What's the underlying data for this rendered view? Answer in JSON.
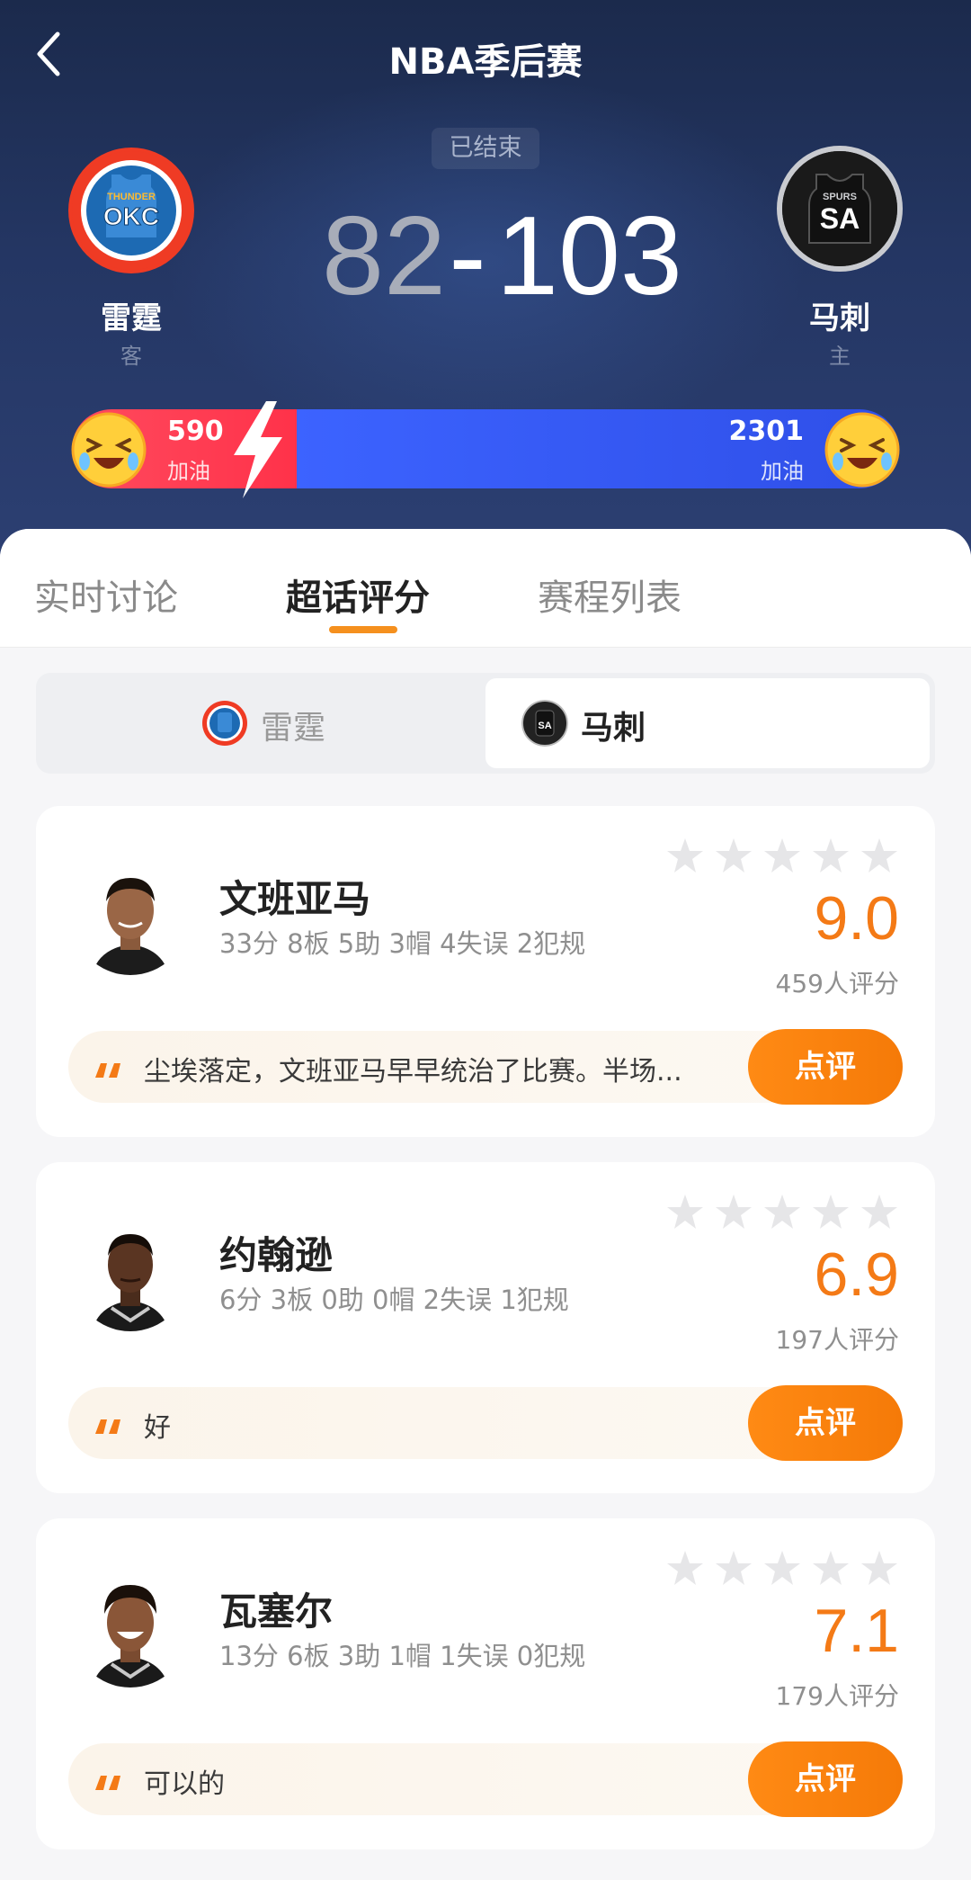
{
  "header": {
    "title": "NBA季后赛",
    "status": "已结束",
    "score": {
      "away": "82",
      "separator": "-",
      "home": "103"
    },
    "away": {
      "name": "雷霆",
      "tag": "客",
      "logo_text_top": "THUNDER",
      "logo_text": "OKC",
      "cheer_count": "590",
      "cheer_label": "加油"
    },
    "home": {
      "name": "马刺",
      "tag": "主",
      "logo_text_top": "SPURS",
      "logo_text": "SA",
      "cheer_count": "2301",
      "cheer_label": "加油"
    }
  },
  "tabs": [
    "实时讨论",
    "超话评分",
    "赛程列表"
  ],
  "active_tab": "超话评分",
  "team_switch": {
    "away_label": "雷霆",
    "home_label": "马刺",
    "selected": "马刺"
  },
  "players": [
    {
      "name": "文班亚马",
      "stats": "33分 8板 5助 3帽 4失误 2犯规",
      "score": "9.0",
      "raters": "459人评分",
      "comment": "尘埃落定，文班亚马早早统治了比赛。半场...",
      "button": "点评"
    },
    {
      "name": "约翰逊",
      "stats": "6分 3板 0助 0帽 2失误 1犯规",
      "score": "6.9",
      "raters": "197人评分",
      "comment": "好",
      "button": "点评"
    },
    {
      "name": "瓦塞尔",
      "stats": "13分 6板 3助 1帽 1失误 0犯规",
      "score": "7.1",
      "raters": "179人评分",
      "comment": "可以的",
      "button": "点评"
    }
  ],
  "colors": {
    "accent": "#f47a16",
    "away_red": "#ff3048",
    "home_blue": "#3c63ff",
    "header_bg": "#1f2f55"
  }
}
